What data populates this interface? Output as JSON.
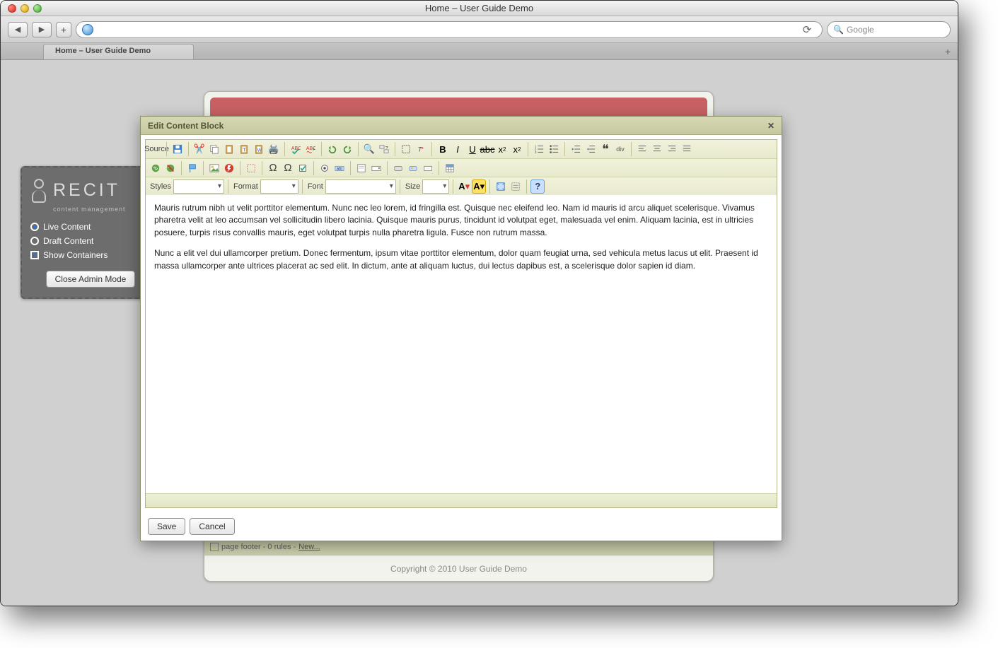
{
  "window": {
    "title": "Home – User Guide Demo"
  },
  "toolbar": {
    "search_placeholder": "Google",
    "url_value": ""
  },
  "tabs": [
    {
      "label": "Home – User Guide Demo"
    }
  ],
  "admin": {
    "brand_big": "RECIT",
    "brand_sub": "content management",
    "radios": [
      {
        "label": "Live Content",
        "checked": true,
        "type": "radio"
      },
      {
        "label": "Draft Content",
        "checked": false,
        "type": "radio"
      },
      {
        "label": "Show Containers",
        "checked": true,
        "type": "check"
      }
    ],
    "close_label": "Close Admin Mode"
  },
  "dialog": {
    "title": "Edit Content Block",
    "source_label": "Source",
    "selects": {
      "styles": "Styles",
      "format": "Format",
      "font": "Font",
      "size": "Size"
    },
    "content_p1": "Mauris rutrum nibh ut velit porttitor elementum. Nunc nec leo lorem, id fringilla est. Quisque nec eleifend leo. Nam id mauris id arcu aliquet scelerisque. Vivamus pharetra velit at leo accumsan vel sollicitudin libero lacinia. Quisque mauris purus, tincidunt id volutpat eget, malesuada vel enim. Aliquam lacinia, est in ultricies posuere, turpis risus convallis mauris, eget volutpat turpis nulla pharetra ligula. Fusce non rutrum massa.",
    "content_p2": "Nunc a elit vel dui ullamcorper pretium. Donec fermentum, ipsum vitae porttitor elementum, dolor quam feugiat urna, sed vehicula metus lacus ut elit. Praesent id massa ullamcorper ante ultrices placerat ac sed elit. In dictum, ante at aliquam luctus, dui lectus dapibus est, a scelerisque dolor sapien id diam.",
    "save_label": "Save",
    "cancel_label": "Cancel"
  },
  "page": {
    "footer_label": "page footer - 0 rules -",
    "footer_new": "New...",
    "copyright": "Copyright © 2010 User Guide Demo"
  }
}
